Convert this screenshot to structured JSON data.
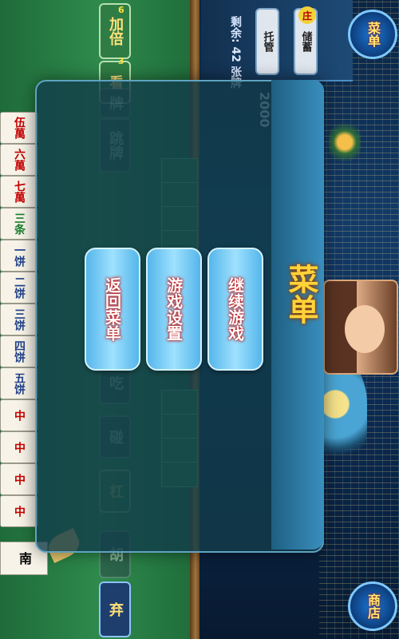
{
  "top": {
    "badge": "庄",
    "chip1": "储蓄",
    "chip2": "托管",
    "remain_label": "剩余:",
    "remain_value": "42",
    "remain_unit": "张牌",
    "coins": "2000",
    "mode_label": "菜单",
    "shop_label": "商店"
  },
  "side": {
    "double_label": "加倍",
    "double_num": "6",
    "see_label": "看",
    "see_num": "3",
    "pai_label": "牌",
    "skip_label": "跳牌",
    "chi_label": "吃",
    "peng_label": "碰",
    "gang_label": "杠",
    "hu_label": "胡",
    "discard_label": "弃"
  },
  "hand": [
    {
      "text": "伍萬",
      "color": "red"
    },
    {
      "text": "六萬",
      "color": "red"
    },
    {
      "text": "七萬",
      "color": "red"
    },
    {
      "text": "三条",
      "color": "green"
    },
    {
      "text": "一饼",
      "color": "blue"
    },
    {
      "text": "二饼",
      "color": "blue"
    },
    {
      "text": "三饼",
      "color": "blue"
    },
    {
      "text": "四饼",
      "color": "blue"
    },
    {
      "text": "五饼",
      "color": "blue"
    },
    {
      "text": "中",
      "color": "red"
    },
    {
      "text": "中",
      "color": "red"
    },
    {
      "text": "中",
      "color": "red"
    },
    {
      "text": "中",
      "color": "red"
    }
  ],
  "bottom_tile": "南",
  "title": "菜单",
  "menu": {
    "continue": "继续游戏",
    "settings": "游戏设置",
    "back": "返回菜单"
  }
}
